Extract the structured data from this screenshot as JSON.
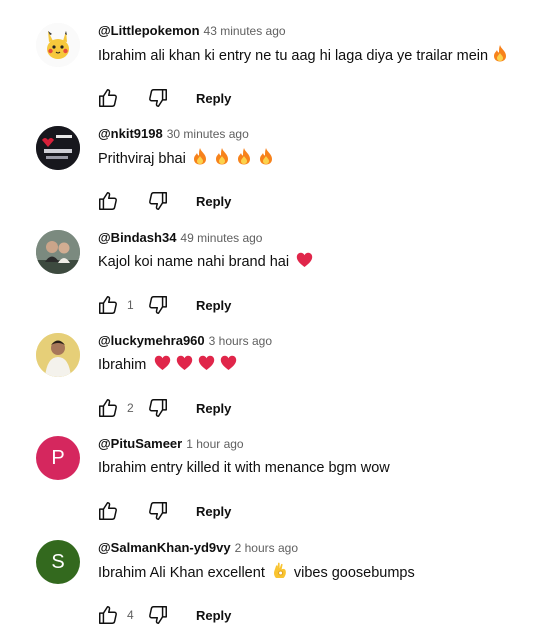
{
  "comments": [
    {
      "author": "@Littlepokemon",
      "time": "43 minutes ago",
      "text": "Ibrahim ali khan ki entry ne tu aag hi laga diya ye trailar mein",
      "emoji": "🔥",
      "likes": "",
      "reply_label": "Reply",
      "avatar": "pokemon-avatar"
    },
    {
      "author": "@nkit9198",
      "time": "30 minutes ago",
      "text": "Prithviraj bhai",
      "emoji": "🔥 🔥 🔥 🔥",
      "likes": "",
      "reply_label": "Reply",
      "avatar": "photo-avatar"
    },
    {
      "author": "@Bindash34",
      "time": "49 minutes ago",
      "text": "Kajol koi name nahi brand hai",
      "emoji": "❤️",
      "likes": "1",
      "reply_label": "Reply",
      "avatar": "photo-avatar"
    },
    {
      "author": "@luckymehra960",
      "time": "3 hours ago",
      "text": "Ibrahim",
      "emoji": "❤️ ❤️ ❤️ ❤️",
      "likes": "2",
      "reply_label": "Reply",
      "avatar": "photo-avatar"
    },
    {
      "author": "@PituSameer",
      "time": "1 hour ago",
      "text": "Ibrahim entry killed it with menance bgm wow",
      "emoji": "",
      "likes": "",
      "reply_label": "Reply",
      "avatar": "letter-avatar",
      "avatar_letter": "P",
      "avatar_color": "#d5275e"
    },
    {
      "author": "@SalmanKhan-yd9vy",
      "time": "2 hours ago",
      "text": "Ibrahim Ali Khan excellent",
      "emoji": "👌",
      "text_after": "vibes goosebumps",
      "likes": "4",
      "reply_label": "Reply",
      "avatar": "letter-avatar",
      "avatar_letter": "S",
      "avatar_color": "#33691e"
    }
  ]
}
